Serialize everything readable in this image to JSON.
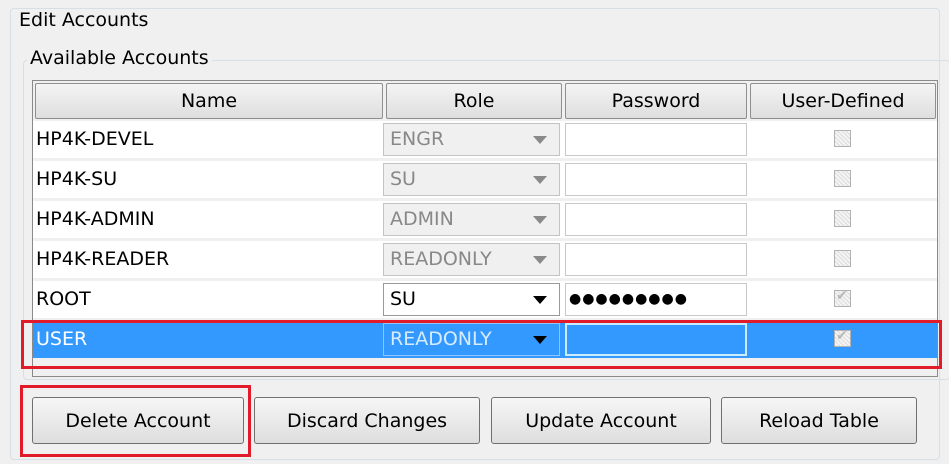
{
  "groups": {
    "edit": "Edit Accounts",
    "available": "Available Accounts"
  },
  "table": {
    "columns": [
      "Name",
      "Role",
      "Password",
      "User-Defined"
    ],
    "rows": [
      {
        "name": "HP4K-DEVEL",
        "role": "ENGR",
        "password": "",
        "user_defined": false,
        "editable": false
      },
      {
        "name": "HP4K-SU",
        "role": "SU",
        "password": "",
        "user_defined": false,
        "editable": false
      },
      {
        "name": "HP4K-ADMIN",
        "role": "ADMIN",
        "password": "",
        "user_defined": false,
        "editable": false
      },
      {
        "name": "HP4K-READER",
        "role": "READONLY",
        "password": "",
        "user_defined": false,
        "editable": false
      },
      {
        "name": "ROOT",
        "role": "SU",
        "password": "●●●●●●●●●",
        "user_defined": true,
        "editable": true
      },
      {
        "name": "USER",
        "role": "READONLY",
        "password": "",
        "user_defined": true,
        "editable": true,
        "selected": true
      }
    ]
  },
  "buttons": {
    "delete": "Delete Account",
    "discard": "Discard Changes",
    "update": "Update Account",
    "reload": "Reload Table"
  },
  "colors": {
    "selection": "#3399ff",
    "highlight": "#e21b2b"
  }
}
